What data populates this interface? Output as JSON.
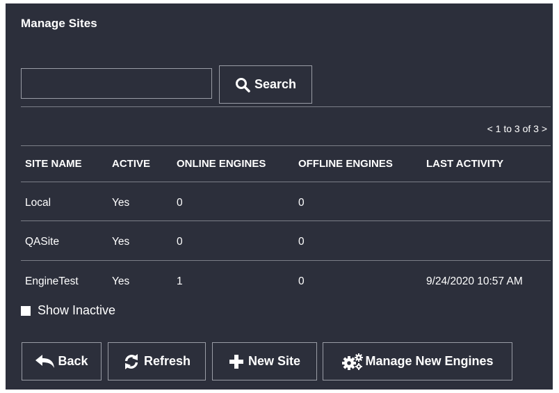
{
  "page": {
    "title": "Manage Sites"
  },
  "search": {
    "value": "",
    "placeholder": "",
    "button_label": "Search"
  },
  "pager": {
    "text": "< 1 to 3 of 3 >"
  },
  "table": {
    "headers": [
      "SITE NAME",
      "ACTIVE",
      "ONLINE ENGINES",
      "OFFLINE ENGINES",
      "LAST ACTIVITY"
    ],
    "rows": [
      [
        "Local",
        "Yes",
        "0",
        "0",
        ""
      ],
      [
        "QASite",
        "Yes",
        "0",
        "0",
        ""
      ],
      [
        "EngineTest",
        "Yes",
        "1",
        "0",
        "9/24/2020 10:57 AM"
      ]
    ]
  },
  "show_inactive": {
    "label": "Show Inactive",
    "checked": false
  },
  "buttons": {
    "back": "Back",
    "refresh": "Refresh",
    "new_site": "New Site",
    "manage_new_engines": "Manage New Engines"
  },
  "icons": {
    "search": "search-icon",
    "back": "back-arrow-icon",
    "refresh": "refresh-icon",
    "new_site": "plus-icon",
    "manage_new_engines": "gears-icon"
  },
  "colors": {
    "panel_bg": "#2c2f3b",
    "border": "#9a9da6",
    "text": "#ffffff"
  }
}
